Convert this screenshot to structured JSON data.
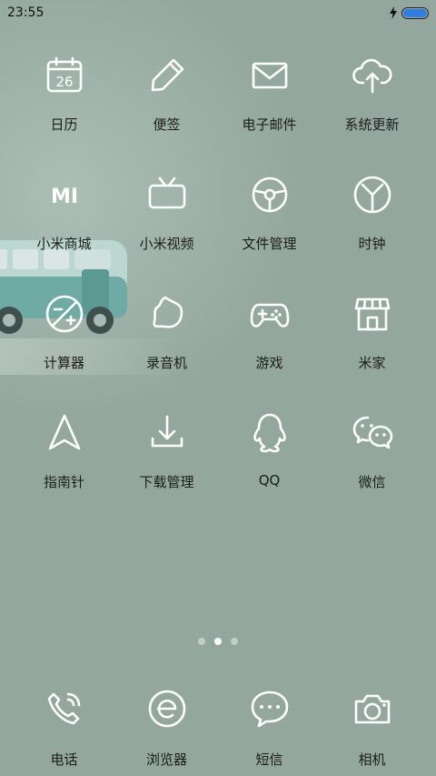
{
  "status_bar": {
    "time": "23:55",
    "charging": true,
    "battery_level": 1.0,
    "accent": "#2f7fe0"
  },
  "apps": [
    [
      {
        "label": "日历",
        "icon": "calendar-icon",
        "icon_text": "26"
      },
      {
        "label": "便签",
        "icon": "note-icon"
      },
      {
        "label": "电子邮件",
        "icon": "mail-icon"
      },
      {
        "label": "系统更新",
        "icon": "cloud-upload-icon"
      }
    ],
    [
      {
        "label": "小米商城",
        "icon": "mi-logo-icon",
        "icon_text": "MI"
      },
      {
        "label": "小米视频",
        "icon": "tv-icon"
      },
      {
        "label": "文件管理",
        "icon": "folder-wheel-icon"
      },
      {
        "label": "时钟",
        "icon": "clock-icon"
      }
    ],
    [
      {
        "label": "计算器",
        "icon": "calculator-icon"
      },
      {
        "label": "录音机",
        "icon": "recorder-icon"
      },
      {
        "label": "游戏",
        "icon": "gamepad-icon"
      },
      {
        "label": "米家",
        "icon": "store-icon"
      }
    ],
    [
      {
        "label": "指南针",
        "icon": "compass-arrow-icon"
      },
      {
        "label": "下载管理",
        "icon": "download-icon"
      },
      {
        "label": "QQ",
        "icon": "qq-penguin-icon"
      },
      {
        "label": "微信",
        "icon": "wechat-icon"
      }
    ]
  ],
  "pages": {
    "count": 3,
    "current": 1
  },
  "dock": [
    {
      "label": "电话",
      "icon": "phone-icon"
    },
    {
      "label": "浏览器",
      "icon": "browser-icon"
    },
    {
      "label": "短信",
      "icon": "message-icon"
    },
    {
      "label": "相机",
      "icon": "camera-icon"
    }
  ]
}
